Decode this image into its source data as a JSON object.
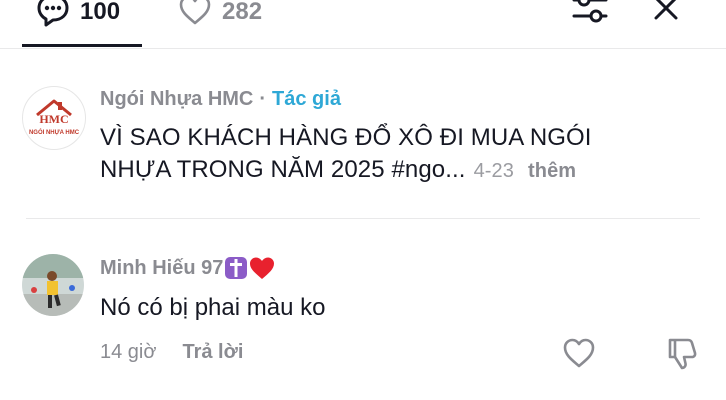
{
  "tabs": {
    "comments_count": "100",
    "likes_count": "282"
  },
  "icons": {
    "comments": "comment-bubble-icon",
    "likes": "heart-outline-icon",
    "filter": "sliders-icon",
    "close": "close-icon"
  },
  "post": {
    "author": "Ngói Nhựa HMC",
    "separator": "·",
    "author_badge": "Tác giả",
    "text": "VÌ SAO KHÁCH HÀNG ĐỔ XÔ ĐI MUA NGÓI NHỰA TRONG NĂM 2025 #ngo...",
    "date": "4-23",
    "more_label": "thêm",
    "avatar_logo_text": "NGÓI NHỰA HMC",
    "badge_color": "#2ea8d6"
  },
  "reply": {
    "author": "Minh Hiếu 97",
    "author_emoji": [
      "✝️",
      "❤️"
    ],
    "text": "Nó có bị phai màu ko",
    "time": "14 giờ",
    "reply_label": "Trả lời"
  }
}
